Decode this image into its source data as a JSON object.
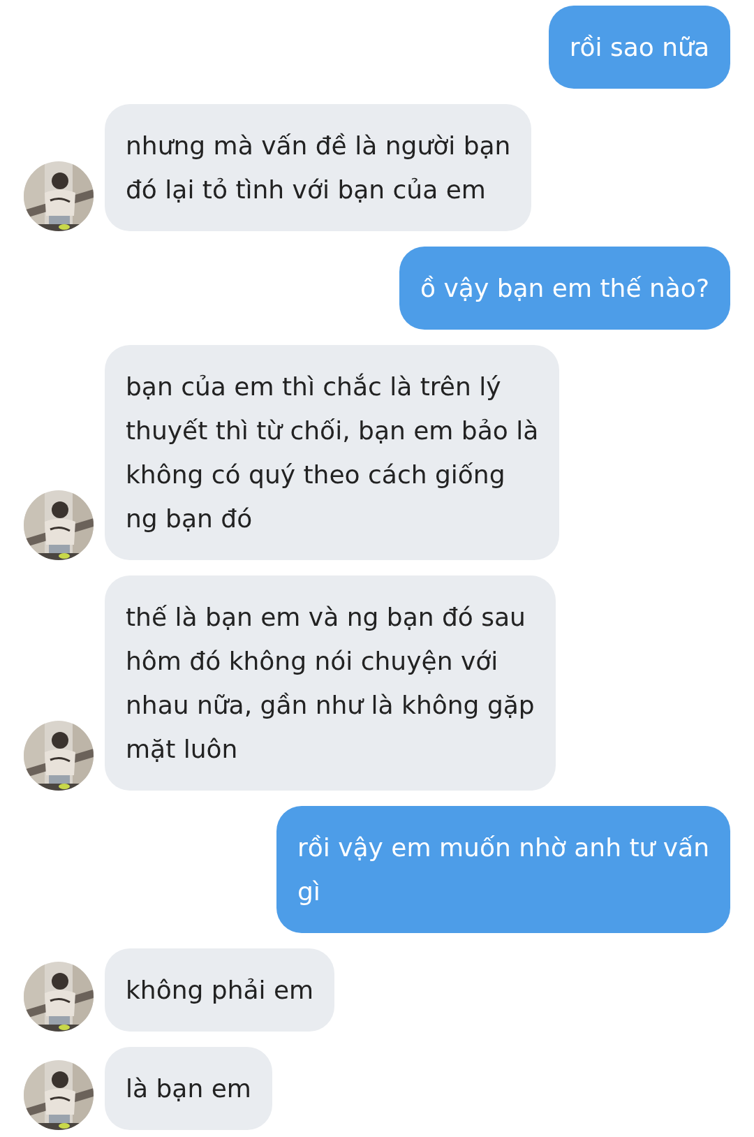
{
  "messages": [
    {
      "kind": "sent",
      "lines": [
        "rồi sao nữa"
      ]
    },
    {
      "kind": "received",
      "lines": [
        "nhưng mà vấn đề là người bạn",
        "đó lại tỏ tình với bạn của em"
      ]
    },
    {
      "kind": "sent",
      "lines": [
        "ồ vậy bạn em thế nào?"
      ]
    },
    {
      "kind": "received",
      "lines": [
        "bạn của em thì chắc là trên lý",
        "thuyết thì từ chối, bạn em bảo là",
        "không có quý theo cách giống",
        "ng bạn đó"
      ]
    },
    {
      "kind": "received",
      "lines": [
        "thế là bạn em và ng bạn đó sau",
        "hôm đó không nói chuyện với",
        "nhau nữa, gần như là không gặp",
        "mặt luôn"
      ]
    },
    {
      "kind": "sent",
      "lines": [
        "rồi vậy em muốn nhờ anh tư vấn",
        "gì"
      ]
    },
    {
      "kind": "received",
      "lines": [
        "không phải em"
      ]
    },
    {
      "kind": "received",
      "lines": [
        "là bạn em"
      ]
    }
  ]
}
